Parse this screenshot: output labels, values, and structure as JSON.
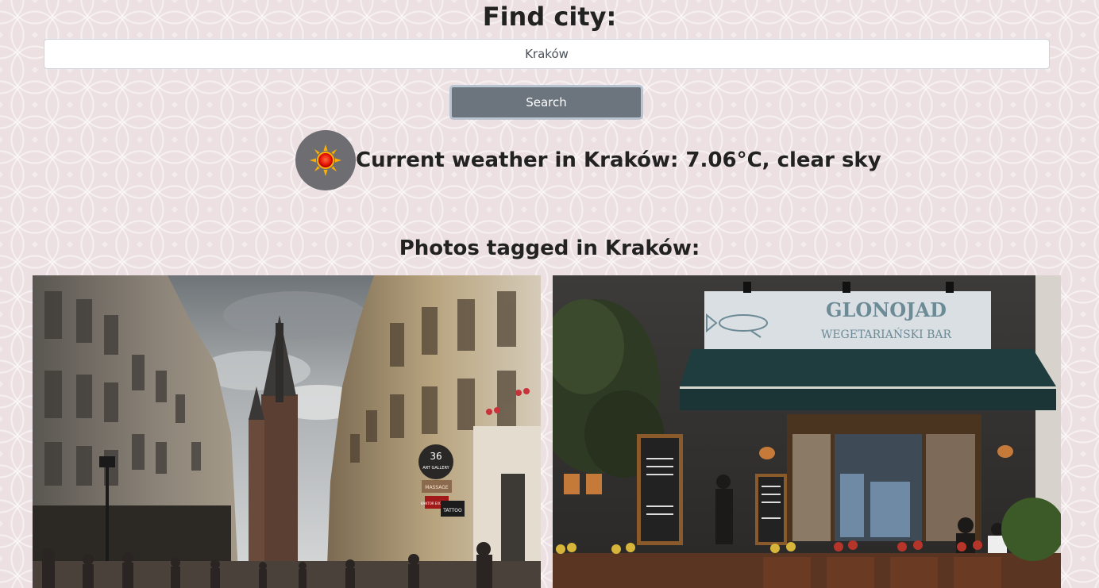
{
  "search": {
    "heading": "Find city:",
    "input_value": "Kraków",
    "button_label": "Search"
  },
  "weather": {
    "icon": "sun-icon",
    "text": "Current weather in Kraków: 7.06°C, clear sky"
  },
  "photos": {
    "heading": "Photos tagged in Kraków:",
    "items": [
      {
        "description_icon": "street-photo",
        "signs": [
          "36",
          "ART GALLERY",
          "MASSAGE",
          "KANTOR EXCHANGE",
          "TATTOO"
        ]
      },
      {
        "description_icon": "restaurant-photo",
        "sign_line1": "GLONOJAD",
        "sign_line2": "WEGETARIAŃSKI BAR"
      }
    ]
  },
  "colors": {
    "button_bg": "#6c757d",
    "icon_circle": "#6e6e72"
  }
}
